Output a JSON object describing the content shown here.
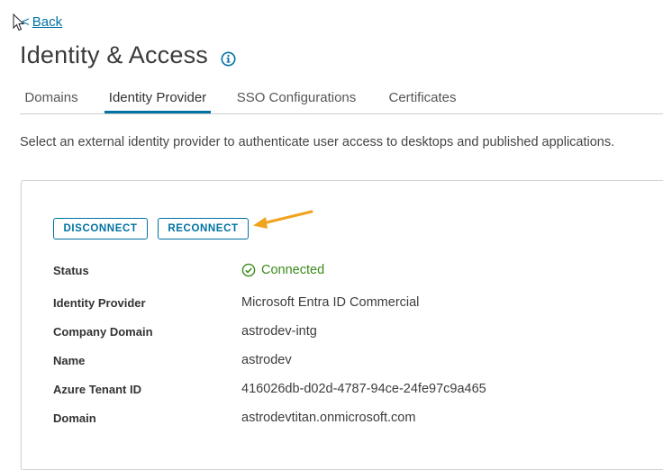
{
  "nav": {
    "back_label": "Back"
  },
  "page": {
    "title": "Identity & Access"
  },
  "tabs": [
    {
      "label": "Domains",
      "active": false
    },
    {
      "label": "Identity Provider",
      "active": true
    },
    {
      "label": "SSO Configurations",
      "active": false
    },
    {
      "label": "Certificates",
      "active": false
    }
  ],
  "description": "Select an external identity provider to authenticate user access to desktops and published applications.",
  "actions": {
    "disconnect_label": "DISCONNECT",
    "reconnect_label": "RECONNECT"
  },
  "details": {
    "status": {
      "label": "Status",
      "value": "Connected"
    },
    "identity_provider": {
      "label": "Identity Provider",
      "value": "Microsoft Entra ID Commercial"
    },
    "company_domain": {
      "label": "Company Domain",
      "value": "astrodev-intg"
    },
    "name": {
      "label": "Name",
      "value": "astrodev"
    },
    "azure_tenant_id": {
      "label": "Azure Tenant ID",
      "value": "416026db-d02d-4787-94ce-24fe97c9a465"
    },
    "domain": {
      "label": "Domain",
      "value": "astrodevtitan.onmicrosoft.com"
    }
  },
  "colors": {
    "accent": "#0072a3",
    "success": "#3a8a1c",
    "annotation_arrow": "#f0a31c"
  },
  "icons": {
    "mouse_cursor": "cursor-arrow-icon",
    "info": "info-circle-icon",
    "status": "check-circle-icon",
    "annotation": "arrow-left-icon"
  }
}
